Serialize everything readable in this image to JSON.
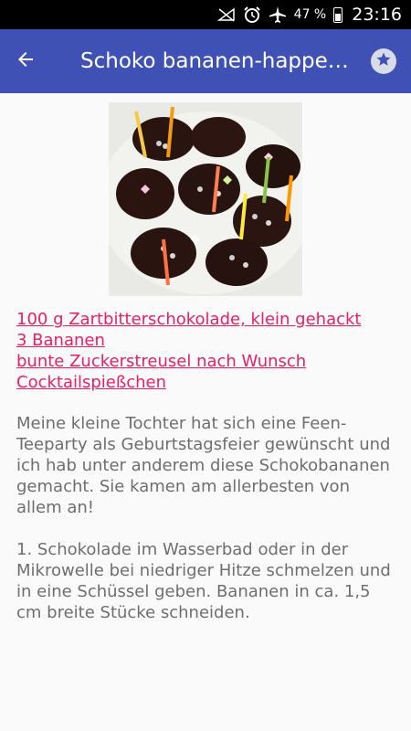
{
  "statusbar": {
    "battery": "47 %",
    "time": "23:16"
  },
  "appbar": {
    "title": "Schoko bananen-happen…"
  },
  "icons": {
    "back": "arrow-back-icon",
    "favorite": "star-icon",
    "nosignal": "no-signal-icon",
    "alarm": "alarm-icon",
    "airplane": "airplane-icon",
    "battery": "battery-icon"
  },
  "colors": {
    "appbar": "#3f51b5",
    "link": "#e91e63",
    "text": "#6e6e6e"
  },
  "ingredients": [
    "100 g Zartbitterschokolade, klein gehackt",
    "3 Bananen",
    "bunte Zuckerstreusel nach Wunsch",
    "Cocktailspießchen"
  ],
  "description": "Meine kleine Tochter hat sich eine Feen-Teeparty als Geburtstagsfeier gewünscht und ich hab unter anderem diese Schokobananen gemacht. Sie kamen am allerbesten von allem an!",
  "step1": "1. Schokolade im Wasserbad oder in der Mikrowelle bei niedriger Hitze schmelzen und in eine Schüssel geben. Bananen in ca. 1,5 cm breite Stücke schneiden."
}
